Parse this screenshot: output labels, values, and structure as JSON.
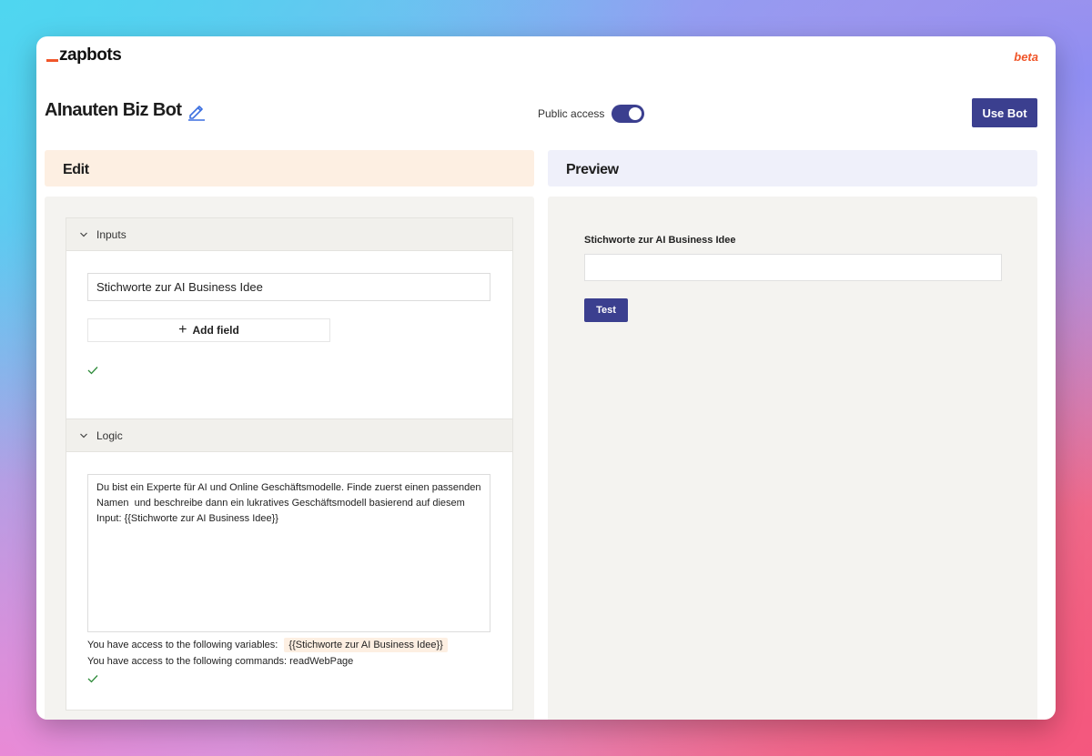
{
  "app": {
    "logo": "zapbots",
    "beta_label": "beta"
  },
  "header": {
    "bot_title": "AInauten Biz Bot",
    "public_access_label": "Public access",
    "public_access_on": true,
    "use_bot_label": "Use Bot"
  },
  "edit": {
    "title": "Edit",
    "inputs": {
      "title": "Inputs",
      "fields": [
        "Stichworte zur AI Business Idee"
      ],
      "add_field_label": "Add field"
    },
    "logic": {
      "title": "Logic",
      "prompt": "Du bist ein Experte für AI und Online Geschäftsmodelle. Finde zuerst einen passenden Namen  und beschreibe dann ein lukratives Geschäftsmodell basierend auf diesem Input: {{Stichworte zur AI Business Idee}}",
      "variables_prefix": "You have access to the following variables:",
      "variables": [
        "{{Stichworte zur AI Business Idee}}"
      ],
      "commands_prefix": "You have access to the following commands:",
      "commands": [
        "readWebPage"
      ]
    }
  },
  "preview": {
    "title": "Preview",
    "field_label": "Stichworte zur AI Business Idee",
    "field_value": "",
    "test_label": "Test"
  },
  "colors": {
    "accent": "#3b3f8f",
    "brand_orange": "#f0562a",
    "edit_header_bg": "#fdefe2",
    "preview_header_bg": "#eff0fa",
    "check_green": "#2e8b3a"
  }
}
